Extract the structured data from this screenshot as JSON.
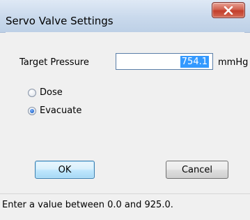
{
  "window": {
    "title": "Servo Valve Settings",
    "close_icon": "close-x-icon"
  },
  "form": {
    "target_pressure_label": "Target Pressure",
    "target_pressure_value": "754.1",
    "unit_label": "mmHg"
  },
  "mode": {
    "options": [
      {
        "label": "Dose",
        "checked": false
      },
      {
        "label": "Evacuate",
        "checked": true
      }
    ]
  },
  "buttons": {
    "ok_label": "OK",
    "cancel_label": "Cancel"
  },
  "status": {
    "text": "Enter a value between 0.0 and 925.0."
  },
  "colors": {
    "selection": "#3399ff",
    "close_button": "#c23e2c",
    "title_bar": "#c9d9ec"
  }
}
